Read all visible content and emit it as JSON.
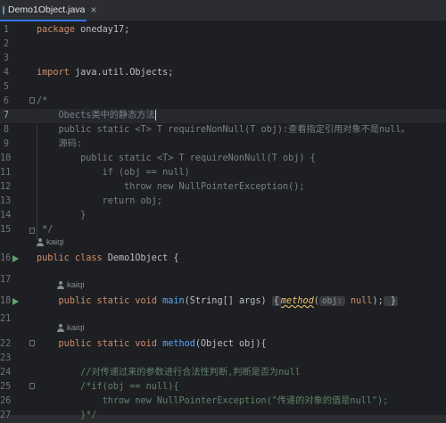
{
  "tab": {
    "filename": "Demo1Object.java",
    "close": "×",
    "icon": "java-class-icon"
  },
  "authors": {
    "class_author": "kaiqi",
    "main_author": "kaiqi",
    "method_author": "kaiqi"
  },
  "lines": [
    {
      "n": "1",
      "tokens": [
        [
          "kw",
          "package "
        ],
        [
          "",
          "oneday17;"
        ]
      ]
    },
    {
      "n": "2",
      "tokens": []
    },
    {
      "n": "3",
      "tokens": []
    },
    {
      "n": "4",
      "tokens": [
        [
          "kw",
          "import "
        ],
        [
          "",
          "java.util.Objects;"
        ]
      ]
    },
    {
      "n": "5",
      "tokens": []
    },
    {
      "n": "6",
      "tokens": [
        [
          "cm",
          "/*"
        ]
      ]
    },
    {
      "n": "7",
      "tokens": [
        [
          "cm",
          "    Obects类中的静态方法"
        ]
      ]
    },
    {
      "n": "8",
      "tokens": [
        [
          "cm",
          "    public static <T> T requireNonNull(T obj):查看指定引用对象不是null。"
        ]
      ]
    },
    {
      "n": "9",
      "tokens": [
        [
          "cm",
          "    源码:"
        ]
      ]
    },
    {
      "n": "10",
      "tokens": [
        [
          "cm",
          "        public static <T> T requireNonNull(T obj) {"
        ]
      ]
    },
    {
      "n": "11",
      "tokens": [
        [
          "cm",
          "            if (obj == null)"
        ]
      ]
    },
    {
      "n": "12",
      "tokens": [
        [
          "cm",
          "                throw new NullPointerException();"
        ]
      ]
    },
    {
      "n": "13",
      "tokens": [
        [
          "cm",
          "            return obj;"
        ]
      ]
    },
    {
      "n": "14",
      "tokens": [
        [
          "cm",
          "        }"
        ]
      ]
    },
    {
      "n": "15",
      "tokens": [
        [
          "cm",
          " */"
        ]
      ]
    },
    {
      "n": "16",
      "tokens": [
        [
          "kw",
          "public class "
        ],
        [
          "",
          "Demo1Object {"
        ]
      ]
    },
    {
      "n": "17",
      "tokens": []
    },
    {
      "n": "18",
      "tokens": [
        [
          "",
          "    "
        ],
        [
          "kw",
          "public static void "
        ],
        [
          "meth",
          "main"
        ],
        [
          "",
          "(String[] args) "
        ],
        [
          "fi",
          "{"
        ],
        [
          "",
          ""
        ],
        [
          "fn",
          "method"
        ],
        [
          "",
          "("
        ],
        [
          "hint",
          "obj:"
        ],
        [
          "kw",
          " null"
        ],
        [
          "",
          ")"
        ],
        [
          "",
          ";"
        ],
        [
          "fi",
          " }"
        ]
      ]
    },
    {
      "n": "21",
      "tokens": []
    },
    {
      "n": "22",
      "tokens": [
        [
          "",
          "    "
        ],
        [
          "kw",
          "public static void "
        ],
        [
          "meth",
          "method"
        ],
        [
          "",
          "(Object obj){"
        ]
      ]
    },
    {
      "n": "23",
      "tokens": []
    },
    {
      "n": "24",
      "tokens": [
        [
          "cmt",
          "        //对传递过来的参数进行合法性判断,判断是否为null"
        ]
      ]
    },
    {
      "n": "25",
      "tokens": [
        [
          "cmt",
          "        /*if(obj == null){"
        ]
      ]
    },
    {
      "n": "26",
      "tokens": [
        [
          "cmt",
          "            throw new NullPointerException(\"传递的对象的值是null\");"
        ]
      ]
    },
    {
      "n": "27",
      "tokens": [
        [
          "cmt",
          "        }*/"
        ]
      ]
    }
  ],
  "colors": {
    "accent": "#3574f0",
    "run": "#59a869",
    "keyword": "#cf8e6d",
    "comment": "#7a7e85"
  }
}
